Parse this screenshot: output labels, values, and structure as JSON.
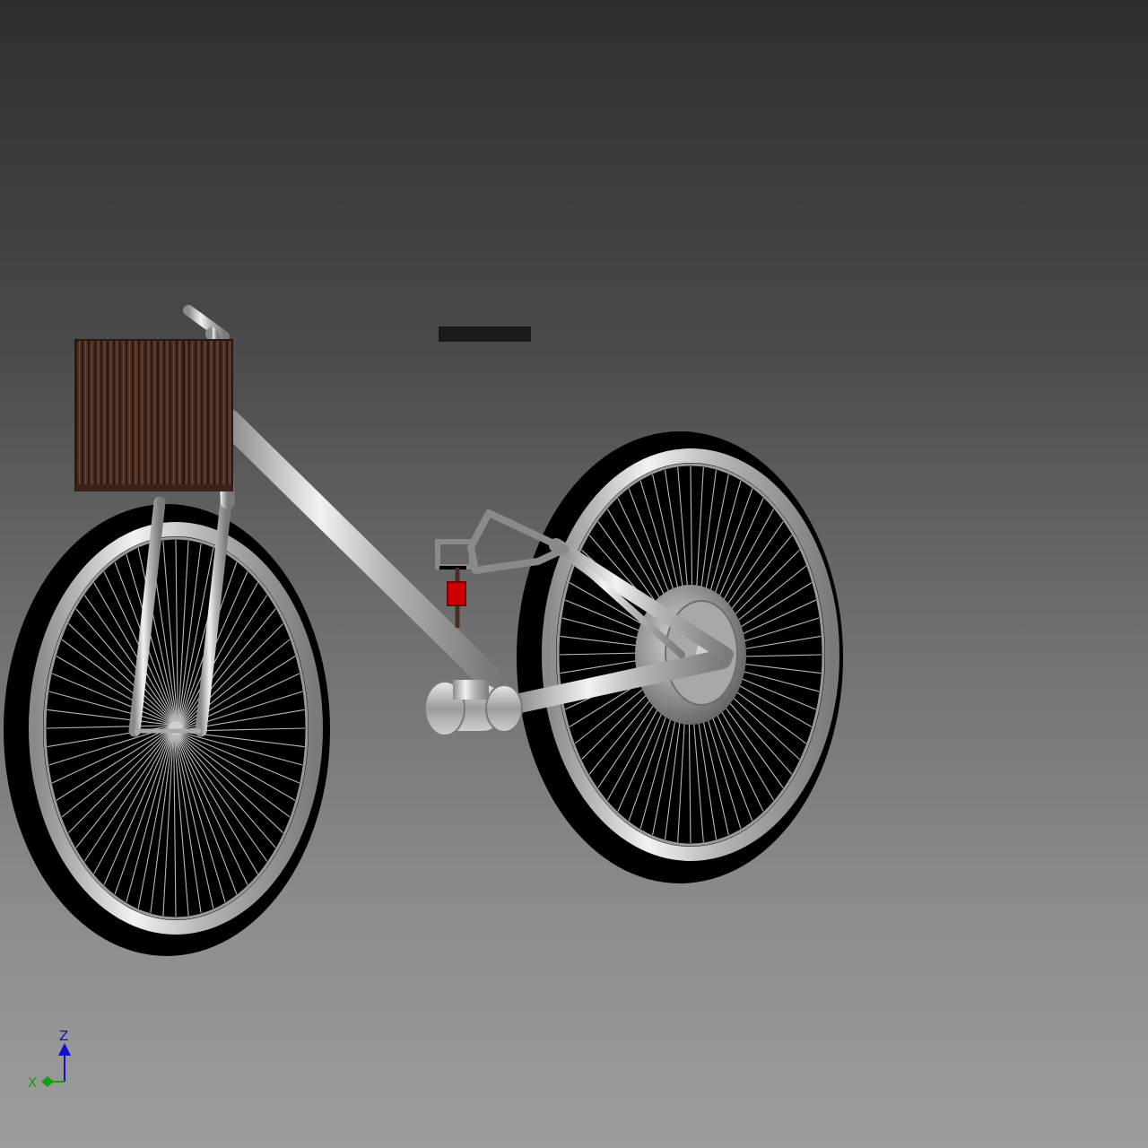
{
  "viewport": {
    "background_top": "#2e2e2e",
    "background_bottom": "#9d9d9d"
  },
  "model": {
    "frame_color": "#c8c8c8",
    "basket_color": "#4a2e22",
    "tire_color": "#000000",
    "seat_color": "#1a1a1a",
    "accent_color": "#cc0000"
  },
  "axes": {
    "z_label": "Z",
    "x_label": "X",
    "z_color": "#1010d0",
    "x_color": "#10a010"
  }
}
